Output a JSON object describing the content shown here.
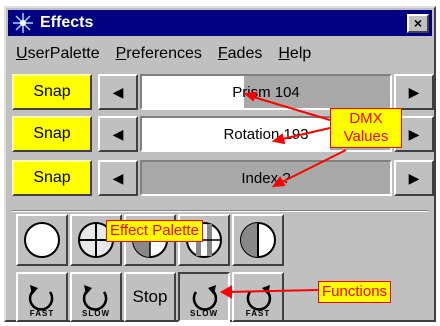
{
  "window": {
    "title": "Effects",
    "close_glyph": "×"
  },
  "menu": [
    {
      "mnemonic": "U",
      "rest": "serPalette"
    },
    {
      "mnemonic": "P",
      "rest": "references"
    },
    {
      "mnemonic": "F",
      "rest": "ades"
    },
    {
      "mnemonic": "H",
      "rest": "elp"
    }
  ],
  "rows": [
    {
      "snap": "Snap",
      "label": "Prism 104",
      "fill_fraction": 0.41
    },
    {
      "snap": "Snap",
      "label": "Rotation 193",
      "fill_fraction": 0.76
    },
    {
      "snap": "Snap",
      "label": "Index ?",
      "fill_fraction": 0.0
    }
  ],
  "arrows": {
    "left": "◀",
    "right": "▶"
  },
  "palette": {
    "callout": "Effect Palette",
    "icons": [
      "open-circle-icon",
      "crosshair-circle-icon",
      "quartered-circle-icon",
      "striped-circle-icon",
      "half-circle-icon"
    ]
  },
  "functions": {
    "callout": "Functions",
    "buttons": [
      {
        "icon": "rotate-left-icon",
        "caption": "FAST"
      },
      {
        "icon": "rotate-left-icon",
        "caption": "SLOW"
      },
      {
        "icon": null,
        "caption": "Stop"
      },
      {
        "icon": "rotate-right-icon",
        "caption": "SLOW"
      },
      {
        "icon": "rotate-right-icon",
        "caption": "FAST"
      }
    ]
  },
  "dmx_callout": {
    "line1": "DMX",
    "line2": "Values"
  },
  "colors": {
    "title_bar": "#000080",
    "snap": "#ffff00",
    "callout_text": "#ff0000",
    "face": "#c0c0c0"
  }
}
